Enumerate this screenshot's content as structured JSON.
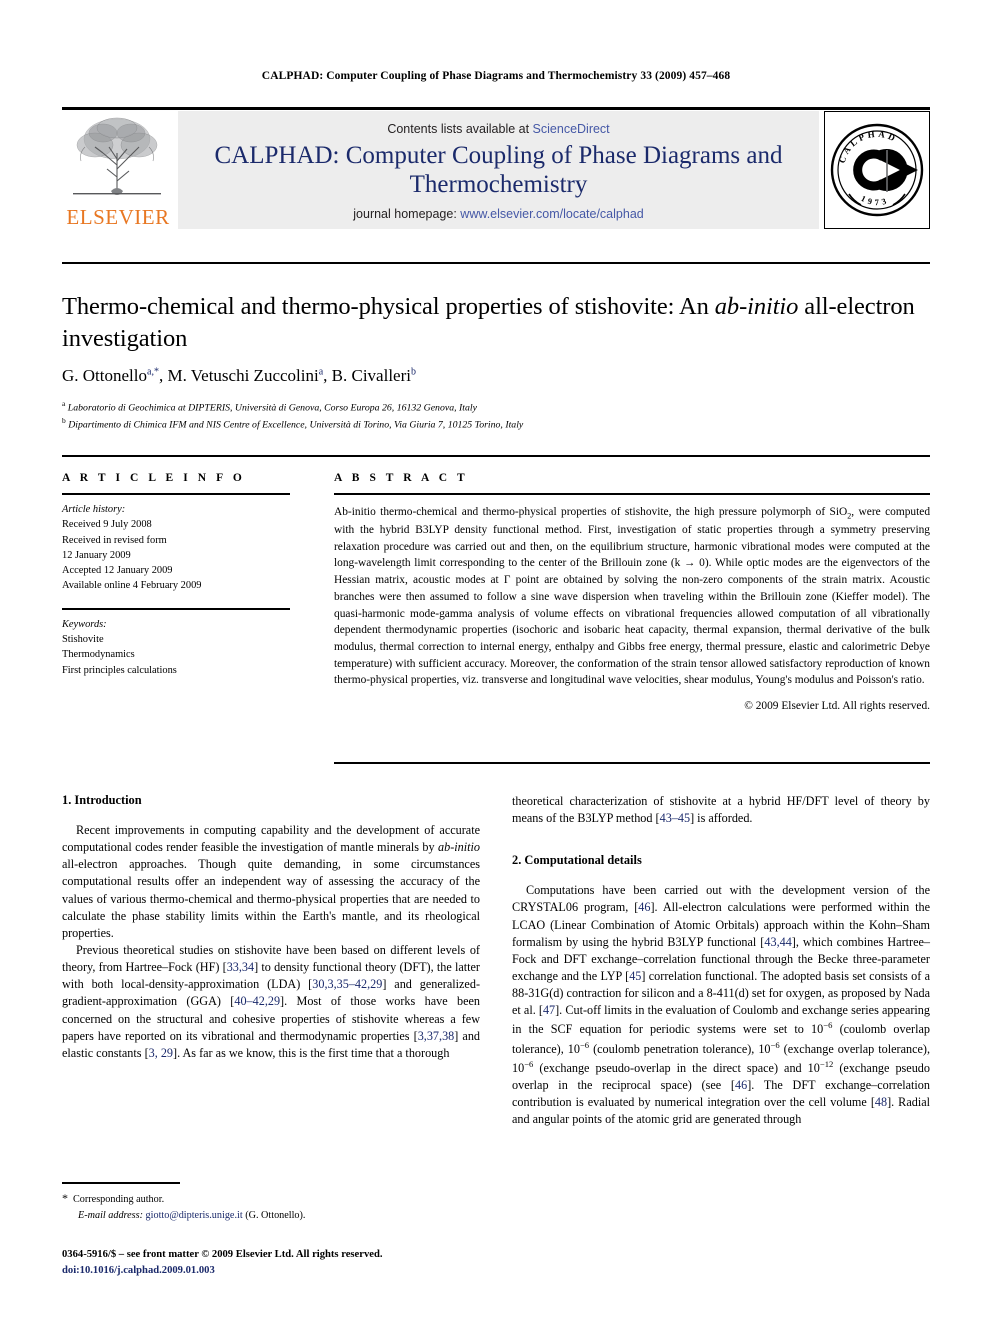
{
  "running_head": "CALPHAD: Computer Coupling of Phase Diagrams and Thermochemistry 33 (2009) 457–468",
  "masthead": {
    "publisher_name": "ELSEVIER",
    "contents_prefix": "Contents lists available at ",
    "contents_link": "ScienceDirect",
    "journal_title": "CALPHAD: Computer Coupling of Phase Diagrams and Thermochemistry",
    "homepage_prefix": "journal homepage: ",
    "homepage_url": "www.elsevier.com/locate/calphad",
    "journal_logo_letters": "CALPHAD",
    "journal_logo_year": "1973",
    "accent_color": "#E87722",
    "link_color": "#4558a6",
    "title_color": "#1b2a6b",
    "band_color": "#EDEDED"
  },
  "article": {
    "title_part1": "Thermo-chemical and thermo-physical properties of stishovite: An ",
    "title_italic": "ab-initio",
    "title_part2": " all-electron investigation",
    "authors": [
      {
        "name": "G. Ottonello",
        "marks": "a,*"
      },
      {
        "name": "M. Vetuschi Zuccolini",
        "marks": "a"
      },
      {
        "name": "B. Civalleri",
        "marks": "b"
      }
    ],
    "affiliations": [
      {
        "mark": "a",
        "text": "Laboratorio di Geochimica at DIPTERIS, Università di Genova, Corso Europa 26, 16132 Genova, Italy"
      },
      {
        "mark": "b",
        "text": "Dipartimento di Chimica IFM and NIS Centre of Excellence, Università di Torino, Via Giuria 7, 10125 Torino, Italy"
      }
    ]
  },
  "article_info": {
    "heading": "A R T I C L E   I N F O",
    "history_label": "Article history:",
    "history": [
      "Received 9 July 2008",
      "Received in revised form",
      "12 January 2009",
      "Accepted 12 January 2009",
      "Available online 4 February 2009"
    ],
    "keywords_label": "Keywords:",
    "keywords": [
      "Stishovite",
      "Thermodynamics",
      "First principles calculations"
    ]
  },
  "abstract": {
    "heading": "A B S T R A C T",
    "text_1": "Ab-initio thermo-chemical and thermo-physical properties of stishovite, the high pressure polymorph of SiO",
    "text_sub": "2",
    "text_2": ", were computed with the hybrid B3LYP density functional method. First, investigation of static properties through a symmetry preserving relaxation procedure was carried out and then, on the equilibrium structure, harmonic vibrational modes were computed at the long-wavelength limit corresponding to the center of the Brillouin zone (k → 0). While optic modes are the eigenvectors of the Hessian matrix, acoustic modes at Γ point are obtained by solving the non-zero components of the strain matrix. Acoustic branches were then assumed to follow a sine wave dispersion when traveling within the Brillouin zone (Kieffer model). The quasi-harmonic mode-gamma analysis of volume effects on vibrational frequencies allowed computation of all vibrationally dependent thermodynamic properties (isochoric and isobaric heat capacity, thermal expansion, thermal derivative of the bulk modulus, thermal correction to internal energy, enthalpy and Gibbs free energy, thermal pressure, elastic and calorimetric Debye temperature) with sufficient accuracy. Moreover, the conformation of the strain tensor allowed satisfactory reproduction of known thermo-physical properties, viz. transverse and longitudinal wave velocities, shear modulus, Young's modulus and Poisson's ratio.",
    "copyright": "© 2009 Elsevier Ltd. All rights reserved."
  },
  "body": {
    "left": {
      "section1_heading": "1.  Introduction",
      "p1_a": "Recent improvements in computing capability and the development of accurate computational codes render feasible the investigation of mantle minerals by ",
      "p1_italic": "ab-initio",
      "p1_b": " all-electron approaches. Though quite demanding, in some circumstances computational results offer an independent way of assessing the accuracy of the values of various thermo-chemical and thermo-physical properties that are needed to calculate the phase stability limits within the Earth's mantle, and its rheological properties.",
      "p2_a": "Previous theoretical studies on stishovite have been based on different levels of theory, from Hartree–Fock (HF) [",
      "p2_ref1": "33,34",
      "p2_b": "] to density functional theory (DFT), the latter with both local-density-approximation (LDA) [",
      "p2_ref2": "30,3,35–42,29",
      "p2_c": "] and generalized-gradient-approximation (GGA) [",
      "p2_ref3": "40–42,29",
      "p2_d": "]. Most of those works have been concerned on the structural and cohesive properties of stishovite whereas a few papers have reported on its vibrational and thermodynamic properties [",
      "p2_ref4": "3,37,38",
      "p2_e": "] and elastic constants [",
      "p2_ref5": "3, 29",
      "p2_f": "]. As far as we know, this is the first time that a thorough"
    },
    "right": {
      "p_cont_a": "theoretical characterization of stishovite at a hybrid HF/DFT level of theory by means of the B3LYP method [",
      "p_cont_ref": "43–45",
      "p_cont_b": "] is afforded.",
      "section2_heading": "2.  Computational details",
      "p1_a": "Computations have been carried out with the development version of the CRYSTAL06 program, [",
      "p1_ref1": "46",
      "p1_b": "]. All-electron calculations were performed within the LCAO (Linear Combination of Atomic Orbitals) approach within the Kohn–Sham formalism by using the hybrid B3LYP functional [",
      "p1_ref2": "43,44",
      "p1_c": "], which combines Hartree–Fock and DFT exchange–correlation functional through the Becke three-parameter exchange and the LYP [",
      "p1_ref3": "45",
      "p1_d": "] correlation functional. The adopted basis set consists of a 88-31G(d) contraction for silicon and a 8-411(d) set for oxygen, as proposed by Nada et al. [",
      "p1_ref4": "47",
      "p1_e": "]. Cut-off limits in the evaluation of Coulomb and exchange series appearing in the SCF equation for periodic systems were set to 10",
      "p1_exp1": "−6",
      "p1_f": " (coulomb overlap tolerance), 10",
      "p1_exp2": "−6",
      "p1_g": " (coulomb penetration tolerance), 10",
      "p1_exp3": "−6",
      "p1_h": " (exchange overlap tolerance), 10",
      "p1_exp4": "−6",
      "p1_i": " (exchange pseudo-overlap in the direct space) and 10",
      "p1_exp5": "−12",
      "p1_j": " (exchange pseudo overlap in the reciprocal space) (see [",
      "p1_ref5": "46",
      "p1_k": "]. The DFT exchange–correlation contribution is evaluated by numerical integration over the cell volume [",
      "p1_ref6": "48",
      "p1_l": "]. Radial and angular points of the atomic grid are generated through"
    }
  },
  "footnote": {
    "corresponding_author": "Corresponding author.",
    "email_label": "E-mail address:",
    "email": "giotto@dipteris.unige.it",
    "email_owner": "(G. Ottonello)."
  },
  "imprint": {
    "issn_line": "0364-5916/$ – see front matter © 2009 Elsevier Ltd. All rights reserved.",
    "doi_label": "doi:",
    "doi": "10.1016/j.calphad.2009.01.003"
  }
}
